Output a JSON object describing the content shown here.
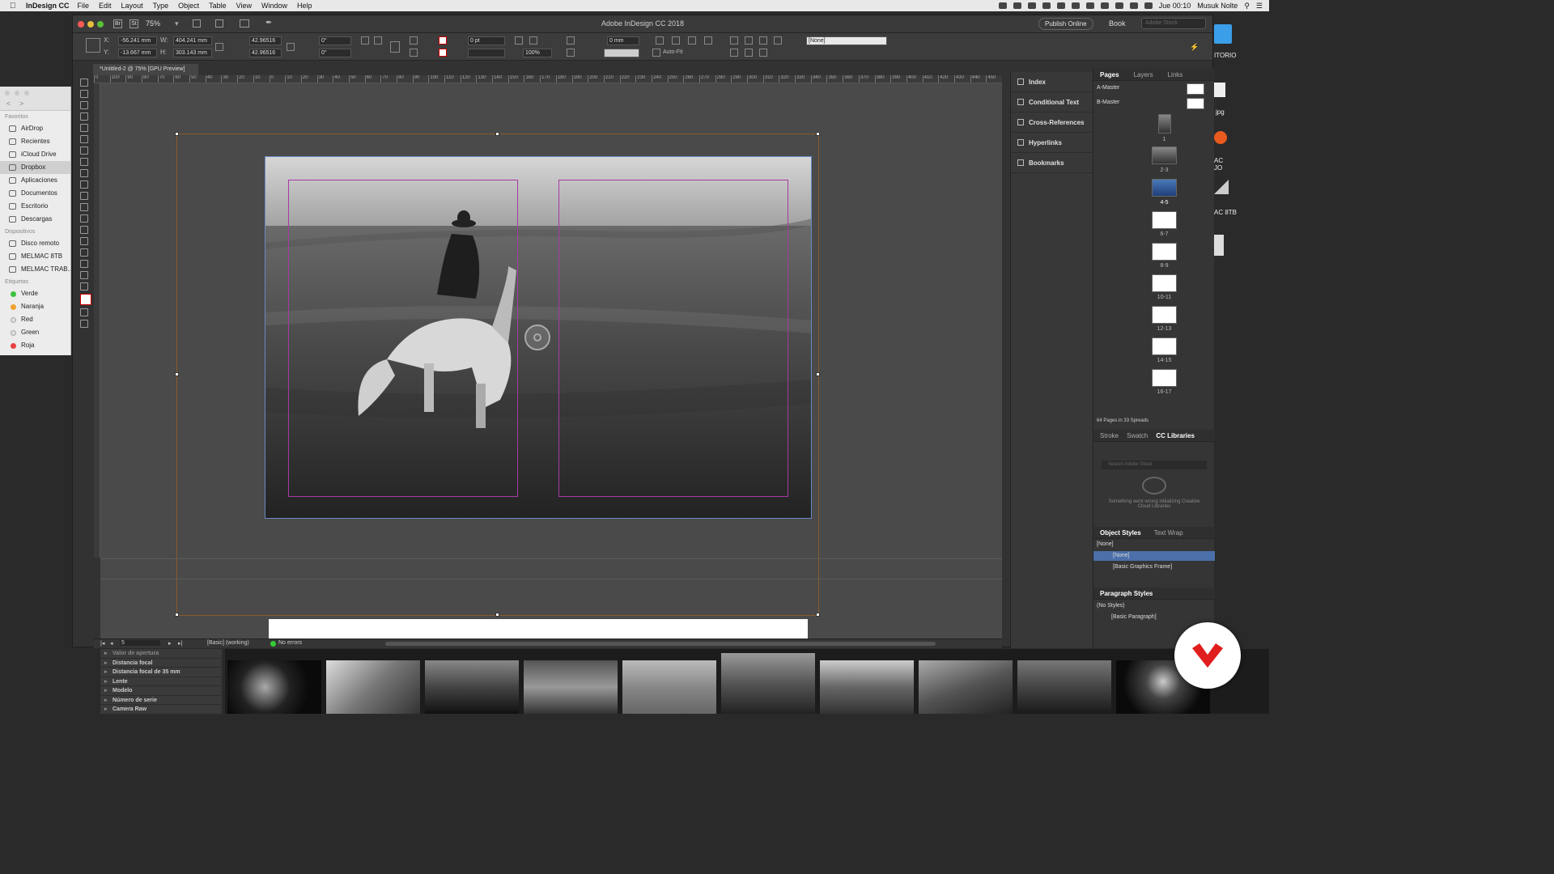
{
  "menubar": {
    "app": "InDesign CC",
    "items": [
      "File",
      "Edit",
      "Layout",
      "Type",
      "Object",
      "Table",
      "View",
      "Window",
      "Help"
    ],
    "time": "Jue 00:10",
    "user": "Musuk Nolte"
  },
  "window": {
    "title": "Adobe InDesign CC 2018",
    "zoom": "75%",
    "publish": "Publish Online",
    "book": "Book",
    "stock_search_placeholder": "Adobe Stock",
    "doc_tab": "*Untitled-2 @ 75% [GPU Preview]"
  },
  "control": {
    "x": "-56.241 mm",
    "y": "-13.667 mm",
    "w": "404.241 mm",
    "h": "303.143 mm",
    "scale_x": "42.96516",
    "scale_y": "42.96516",
    "angle": "0°",
    "shear": "0°",
    "stroke": "0 pt",
    "opacity": "100%",
    "offset": "0 mm",
    "autofit": "Auto-Fit",
    "object_style": "[None]"
  },
  "ruler": {
    "ticks": [
      "0",
      "100",
      "90",
      "80",
      "70",
      "60",
      "50",
      "40",
      "30",
      "20",
      "10",
      "0",
      "10",
      "20",
      "30",
      "40",
      "50",
      "60",
      "70",
      "80",
      "90",
      "100",
      "110",
      "120",
      "130",
      "140",
      "150",
      "160",
      "170",
      "180",
      "190",
      "200",
      "210",
      "220",
      "230",
      "240",
      "250",
      "260",
      "270",
      "280",
      "290",
      "300",
      "310",
      "320",
      "330",
      "340",
      "350",
      "360",
      "370",
      "380",
      "390",
      "400",
      "410",
      "420",
      "430",
      "440",
      "450"
    ]
  },
  "status": {
    "page": "5",
    "profile": "[Basic] (working)",
    "errors": "No errors"
  },
  "collapsed_panels": [
    "Index",
    "Conditional Text",
    "Cross-References",
    "Hyperlinks",
    "Bookmarks"
  ],
  "pages_panel": {
    "tabs": [
      "Pages",
      "Layers",
      "Links"
    ],
    "masters": [
      "A-Master",
      "B-Master"
    ],
    "spreads": [
      "1",
      "2-3",
      "4-5",
      "6-7",
      "8-9",
      "10-11",
      "12-13",
      "14-15",
      "16-17"
    ],
    "summary": "64 Pages in 33 Spreads"
  },
  "libraries_panel": {
    "tabs": [
      "Stroke",
      "Swatch",
      "CC Libraries"
    ],
    "search_placeholder": "Search Adobe Stock",
    "error": "Something went wrong initializing Creative Cloud Libraries"
  },
  "object_styles": {
    "tabs": [
      "Object Styles",
      "Text Wrap"
    ],
    "current": "[None]",
    "items": [
      "[None]",
      "[Basic Graphics Frame]"
    ]
  },
  "paragraph_styles": {
    "title": "Paragraph Styles",
    "current": "(No Styles)",
    "items": [
      "[Basic Paragraph]"
    ]
  },
  "finder": {
    "favorites_label": "Favoritos",
    "favorites": [
      "AirDrop",
      "Recientes",
      "iCloud Drive",
      "Dropbox",
      "Aplicaciones",
      "Documentos",
      "Escritorio",
      "Descargas"
    ],
    "devices_label": "Dispositivos",
    "devices": [
      "Disco remoto",
      "MELMAC 8TB",
      "MELMAC TRAB..."
    ],
    "tags_label": "Etiquetas",
    "tags": [
      {
        "name": "Verde",
        "color": "#3cc23c"
      },
      {
        "name": "Naranja",
        "color": "#f0a030"
      },
      {
        "name": "Red",
        "color": "#dcdcdc"
      },
      {
        "name": "Green",
        "color": "#dcdcdc"
      },
      {
        "name": "Roja",
        "color": "#e84040"
      }
    ]
  },
  "desktop": {
    "labels": [
      "ITORIO",
      "jpg",
      "AC",
      "JO",
      "AC 8TB"
    ]
  },
  "lightroom": {
    "metadata": [
      "Valor de apertura",
      "Distancia focal",
      "Distancia focal de 35 mm",
      "Lente",
      "Modelo",
      "Número de serie",
      "Camera Raw"
    ]
  },
  "colors": {
    "accent_blue": "#4b6fa8",
    "margin_guide": "#a43ba4",
    "logo_red": "#e01e1e"
  }
}
